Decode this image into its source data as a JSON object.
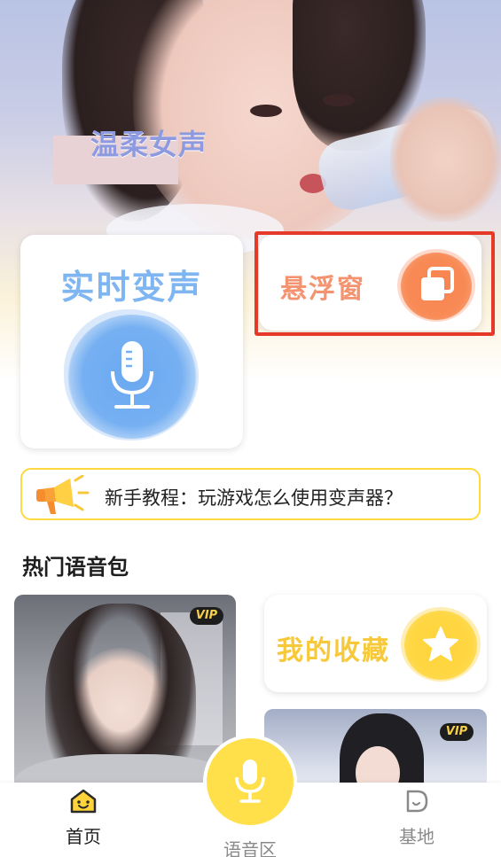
{
  "hero": {
    "tag_text": "温柔女声"
  },
  "realtime_card": {
    "title": "实时变声",
    "icon": "microphone-icon"
  },
  "float_window_card": {
    "title": "悬浮窗",
    "icon": "float-window-icon"
  },
  "tutorial": {
    "text": "新手教程：玩游戏怎么使用变声器？",
    "icon": "megaphone-icon"
  },
  "hot_voice_packs": {
    "title": "热门语音包",
    "items": [
      {
        "badge": "VIP"
      },
      {
        "badge": "VIP"
      }
    ]
  },
  "favorites_card": {
    "title": "我的收藏",
    "icon": "star-icon"
  },
  "tabbar": {
    "items": [
      {
        "label": "首页",
        "icon": "home-smile-icon",
        "active": true
      },
      {
        "label": "语音区",
        "icon": "microphone-icon",
        "active": false
      },
      {
        "label": "基地",
        "icon": "base-icon",
        "active": false
      }
    ]
  },
  "colors": {
    "realtime_blue": "#7fb6f2",
    "float_orange": "#f49370",
    "favorite_yellow": "#f7c93a",
    "highlight_red": "#e53a29",
    "tutorial_border": "#ffd940",
    "tab_mic_yellow": "#ffe04a"
  }
}
